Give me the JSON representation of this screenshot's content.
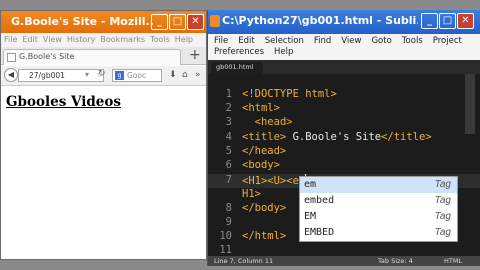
{
  "firefox": {
    "title": "G.Boole's Site - Mozill...",
    "menu": [
      "File",
      "Edit",
      "View",
      "History",
      "Bookmarks",
      "Tools",
      "Help"
    ],
    "tab_title": "G.Boole's Site",
    "new_tab": "+",
    "url": "27/gb001",
    "search_placeholder": "Gooc",
    "page_heading": "Gbooles Videos"
  },
  "sublime": {
    "title": "C:\\Python27\\gb001.html - Subli...",
    "menu_row1": [
      "File",
      "Edit",
      "Selection",
      "Find",
      "View",
      "Goto",
      "Tools",
      "Project"
    ],
    "menu_row2": [
      "Preferences",
      "Help"
    ],
    "tab_label": "gb001.html",
    "line_numbers": [
      "1",
      "2",
      "3",
      "4",
      "5",
      "6",
      "7",
      "",
      "8",
      "9",
      "10",
      "11"
    ],
    "autocomplete": [
      {
        "label": "em",
        "kind": "Tag"
      },
      {
        "label": "embed",
        "kind": "Tag"
      },
      {
        "label": "EM",
        "kind": "Tag"
      },
      {
        "label": "EMBED",
        "kind": "Tag"
      }
    ],
    "status_left": "Line 7, Column 11",
    "status_tab": "Tab Size: 4",
    "status_syntax": "HTML"
  }
}
